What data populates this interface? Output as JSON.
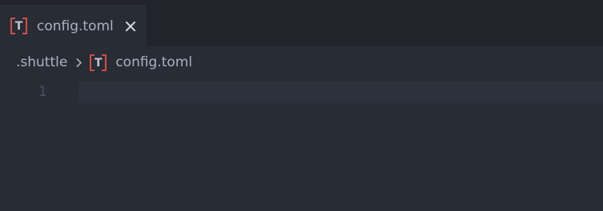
{
  "tab": {
    "icon": "toml-file-icon",
    "label": "config.toml",
    "close": "close-icon"
  },
  "breadcrumb": {
    "folder": ".shuttle",
    "separator": "chevron-right-icon",
    "file_icon": "toml-file-icon",
    "file": "config.toml"
  },
  "editor": {
    "lines": [
      "1"
    ]
  },
  "colors": {
    "background": "#282c34",
    "tab_strip": "#21252b",
    "toml_icon_accent": "#d54d47",
    "text": "#aab1bf",
    "line_number": "#495162",
    "current_line_highlight": "#2c313c"
  }
}
